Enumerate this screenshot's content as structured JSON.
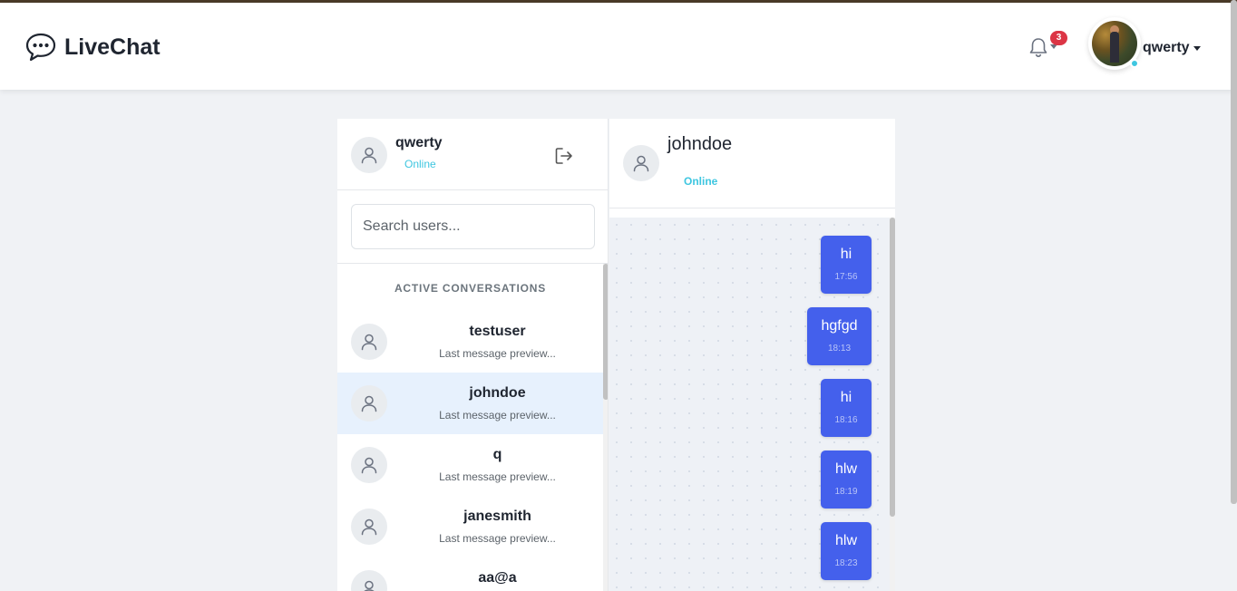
{
  "navbar": {
    "brand_icon": "speech-bubble-icon",
    "brand": "LiveChat",
    "notification_count": "3",
    "username": "qwerty",
    "accent": "#4460ec",
    "online_color": "#3ec6e0",
    "badge_color": "#dc3545"
  },
  "sidebar": {
    "current_user": {
      "name": "qwerty",
      "status": "Online"
    },
    "search": {
      "placeholder": "Search users..."
    },
    "section_title": "ACTIVE CONVERSATIONS",
    "conversations": [
      {
        "name": "testuser",
        "preview": "Last message preview...",
        "active": false
      },
      {
        "name": "johndoe",
        "preview": "Last message preview...",
        "active": true
      },
      {
        "name": "q",
        "preview": "Last message preview...",
        "active": false
      },
      {
        "name": "janesmith",
        "preview": "Last message preview...",
        "active": false
      },
      {
        "name": "aa@a",
        "preview": "",
        "active": false
      }
    ]
  },
  "chat": {
    "contact": {
      "name": "johndoe",
      "status": "Online"
    },
    "messages": [
      {
        "text": "hi",
        "time": "17:56"
      },
      {
        "text": "hgfgd",
        "time": "18:13"
      },
      {
        "text": "hi",
        "time": "18:16"
      },
      {
        "text": "hlw",
        "time": "18:19"
      },
      {
        "text": "hlw",
        "time": "18:23"
      }
    ]
  }
}
